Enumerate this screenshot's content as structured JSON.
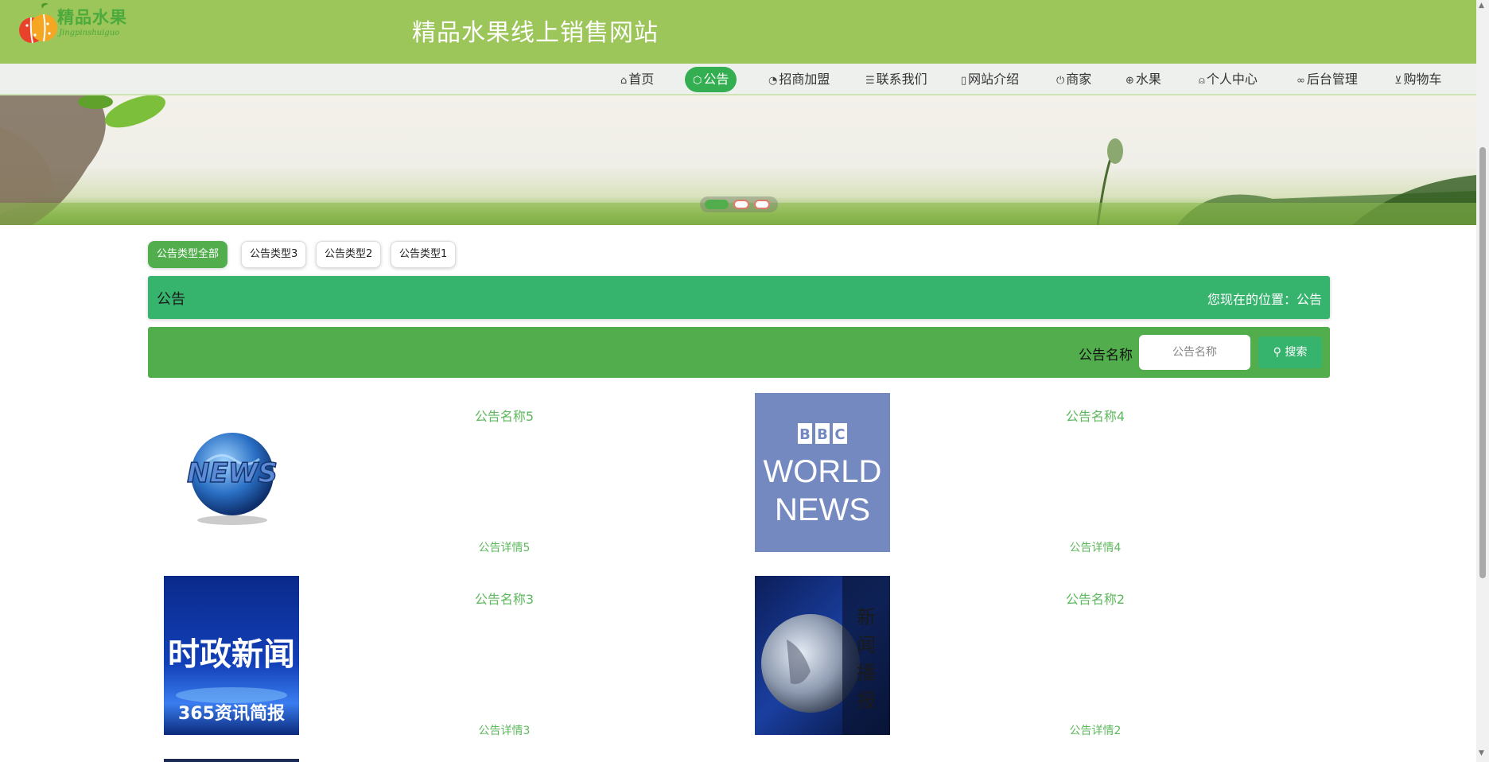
{
  "header": {
    "logo_text": "精品水果",
    "logo_subtext": "Jingpinshuiguo",
    "title": "精品水果线上销售网站"
  },
  "nav": {
    "items": [
      {
        "label": "首页",
        "icon": "home-icon",
        "active": false
      },
      {
        "label": "公告",
        "icon": "cube-icon",
        "active": true
      },
      {
        "label": "招商加盟",
        "icon": "gauge-icon",
        "active": false
      },
      {
        "label": "联系我们",
        "icon": "sliders-icon",
        "active": false
      },
      {
        "label": "网站介绍",
        "icon": "document-icon",
        "active": false
      },
      {
        "label": "商家",
        "icon": "power-icon",
        "active": false
      },
      {
        "label": "水果",
        "icon": "globe-icon",
        "active": false
      },
      {
        "label": "个人中心",
        "icon": "user-icon",
        "active": false
      },
      {
        "label": "后台管理",
        "icon": "link-icon",
        "active": false
      },
      {
        "label": "购物车",
        "icon": "cart-icon",
        "active": false
      }
    ]
  },
  "banner": {
    "slide_count": 3,
    "active_slide": 1
  },
  "categories": [
    "公告类型全部",
    "公告类型3",
    "公告类型2",
    "公告类型1"
  ],
  "location": {
    "title": "公告",
    "path": "您现在的位置：公告"
  },
  "search": {
    "label": "公告名称",
    "placeholder": "公告名称",
    "button": "搜索"
  },
  "notices": [
    {
      "name": "公告名称5",
      "detail": "公告详情5",
      "image_text": "NEWS"
    },
    {
      "name": "公告名称4",
      "detail": "公告详情4",
      "image_text": "BBC WORLD NEWS"
    },
    {
      "name": "公告名称3",
      "detail": "公告详情3",
      "image_text": "时政新闻 365资讯简报"
    },
    {
      "name": "公告名称2",
      "detail": "公告详情2",
      "image_text": "新闻播报"
    }
  ],
  "colors": {
    "header_bg": "#9cc55a",
    "primary_green": "#52ae4c",
    "location_green": "#36b46e",
    "nav_active": "#33ae50",
    "link_green": "#5cb85c"
  }
}
